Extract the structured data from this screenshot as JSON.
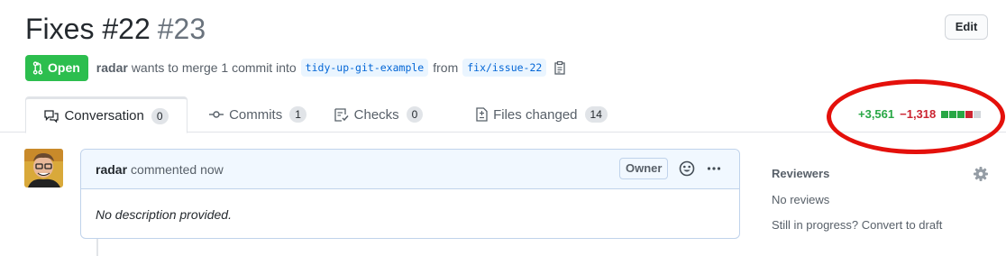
{
  "pr": {
    "title": "Fixes #22",
    "number": "#23",
    "state_label": "Open",
    "author": "radar",
    "merge_text": "wants to merge 1 commit into",
    "base_branch": "tidy-up-git-example",
    "from_text": "from",
    "head_branch": "fix/issue-22",
    "edit_label": "Edit"
  },
  "tabs": [
    {
      "label": "Conversation",
      "count": "0",
      "icon": "comment-discussion-icon"
    },
    {
      "label": "Commits",
      "count": "1",
      "icon": "git-commit-icon"
    },
    {
      "label": "Checks",
      "count": "0",
      "icon": "checklist-icon"
    },
    {
      "label": "Files changed",
      "count": "14",
      "icon": "file-diff-icon"
    }
  ],
  "diffstat": {
    "additions": "+3,561",
    "deletions": "−1,318",
    "blocks": [
      "added",
      "added",
      "added",
      "deleted",
      "neutral"
    ]
  },
  "comment": {
    "author": "radar",
    "action": "commented now",
    "role_badge": "Owner",
    "body": "No description provided."
  },
  "sidebar": {
    "reviewers_heading": "Reviewers",
    "reviewers_value": "No reviews",
    "draft_text": "Still in progress? Convert to draft"
  },
  "colors": {
    "open_green": "#2cbe4e",
    "add_green": "#28a745",
    "del_red": "#cb2431",
    "annotation_ring": "#e4100b"
  }
}
